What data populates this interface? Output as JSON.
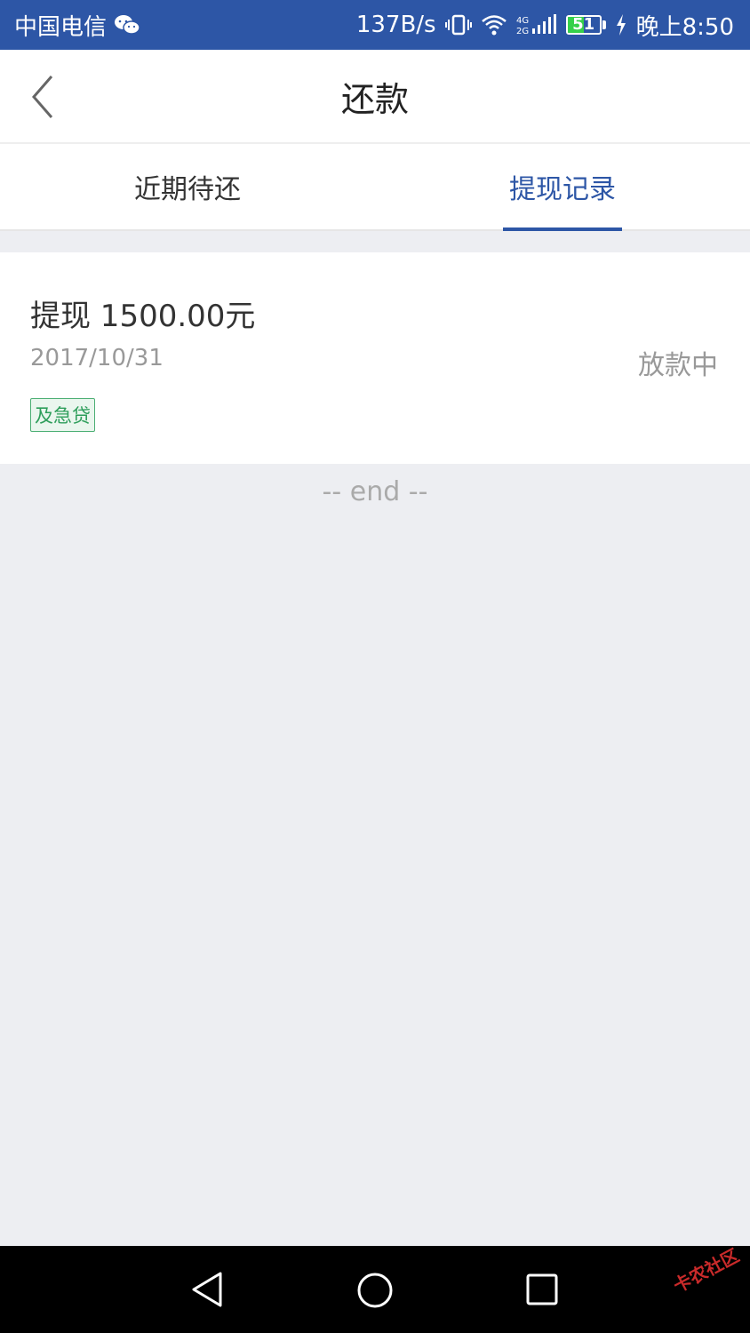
{
  "status_bar": {
    "carrier": "中国电信",
    "net_speed": "137B/s",
    "network_type": "4G 2G",
    "battery": "51",
    "time": "晚上8:50"
  },
  "nav": {
    "title": "还款"
  },
  "tabs": [
    {
      "label": "近期待还",
      "active": false
    },
    {
      "label": "提现记录",
      "active": true
    }
  ],
  "record": {
    "title": "提现 1500.00元",
    "date": "2017/10/31",
    "status": "放款中",
    "tag": "及急贷"
  },
  "list_end": "-- end --",
  "watermark": "卡农社区",
  "colors": {
    "primary": "#2d56a6",
    "tag_green": "#2e9e5b",
    "background": "#edeef2"
  }
}
